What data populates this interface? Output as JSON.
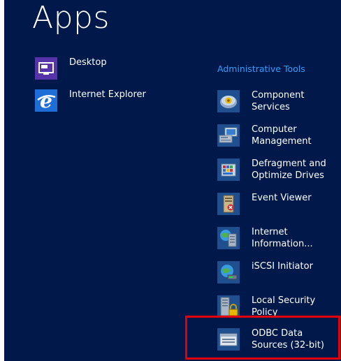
{
  "header": {
    "title": "Apps"
  },
  "apps": [
    {
      "label": "Desktop",
      "icon": "desktop-icon"
    },
    {
      "label": "Internet Explorer",
      "icon": "internet-explorer-icon"
    }
  ],
  "admin_tools": {
    "header": "Administrative Tools",
    "items": [
      {
        "label": "Component Services",
        "icon": "component-services-icon"
      },
      {
        "label": "Computer Management",
        "icon": "computer-management-icon"
      },
      {
        "label": "Defragment and Optimize Drives",
        "icon": "defragment-icon"
      },
      {
        "label": "Event Viewer",
        "icon": "event-viewer-icon"
      },
      {
        "label": "Internet Information...",
        "icon": "iis-icon"
      },
      {
        "label": "iSCSI Initiator",
        "icon": "iscsi-initiator-icon"
      },
      {
        "label": "Local Security Policy",
        "icon": "local-security-policy-icon"
      },
      {
        "label": "ODBC Data Sources (32-bit)",
        "icon": "odbc-icon"
      }
    ]
  },
  "colors": {
    "background": "#00184a",
    "accent": "#2f9fff",
    "highlight": "#e3000b"
  }
}
